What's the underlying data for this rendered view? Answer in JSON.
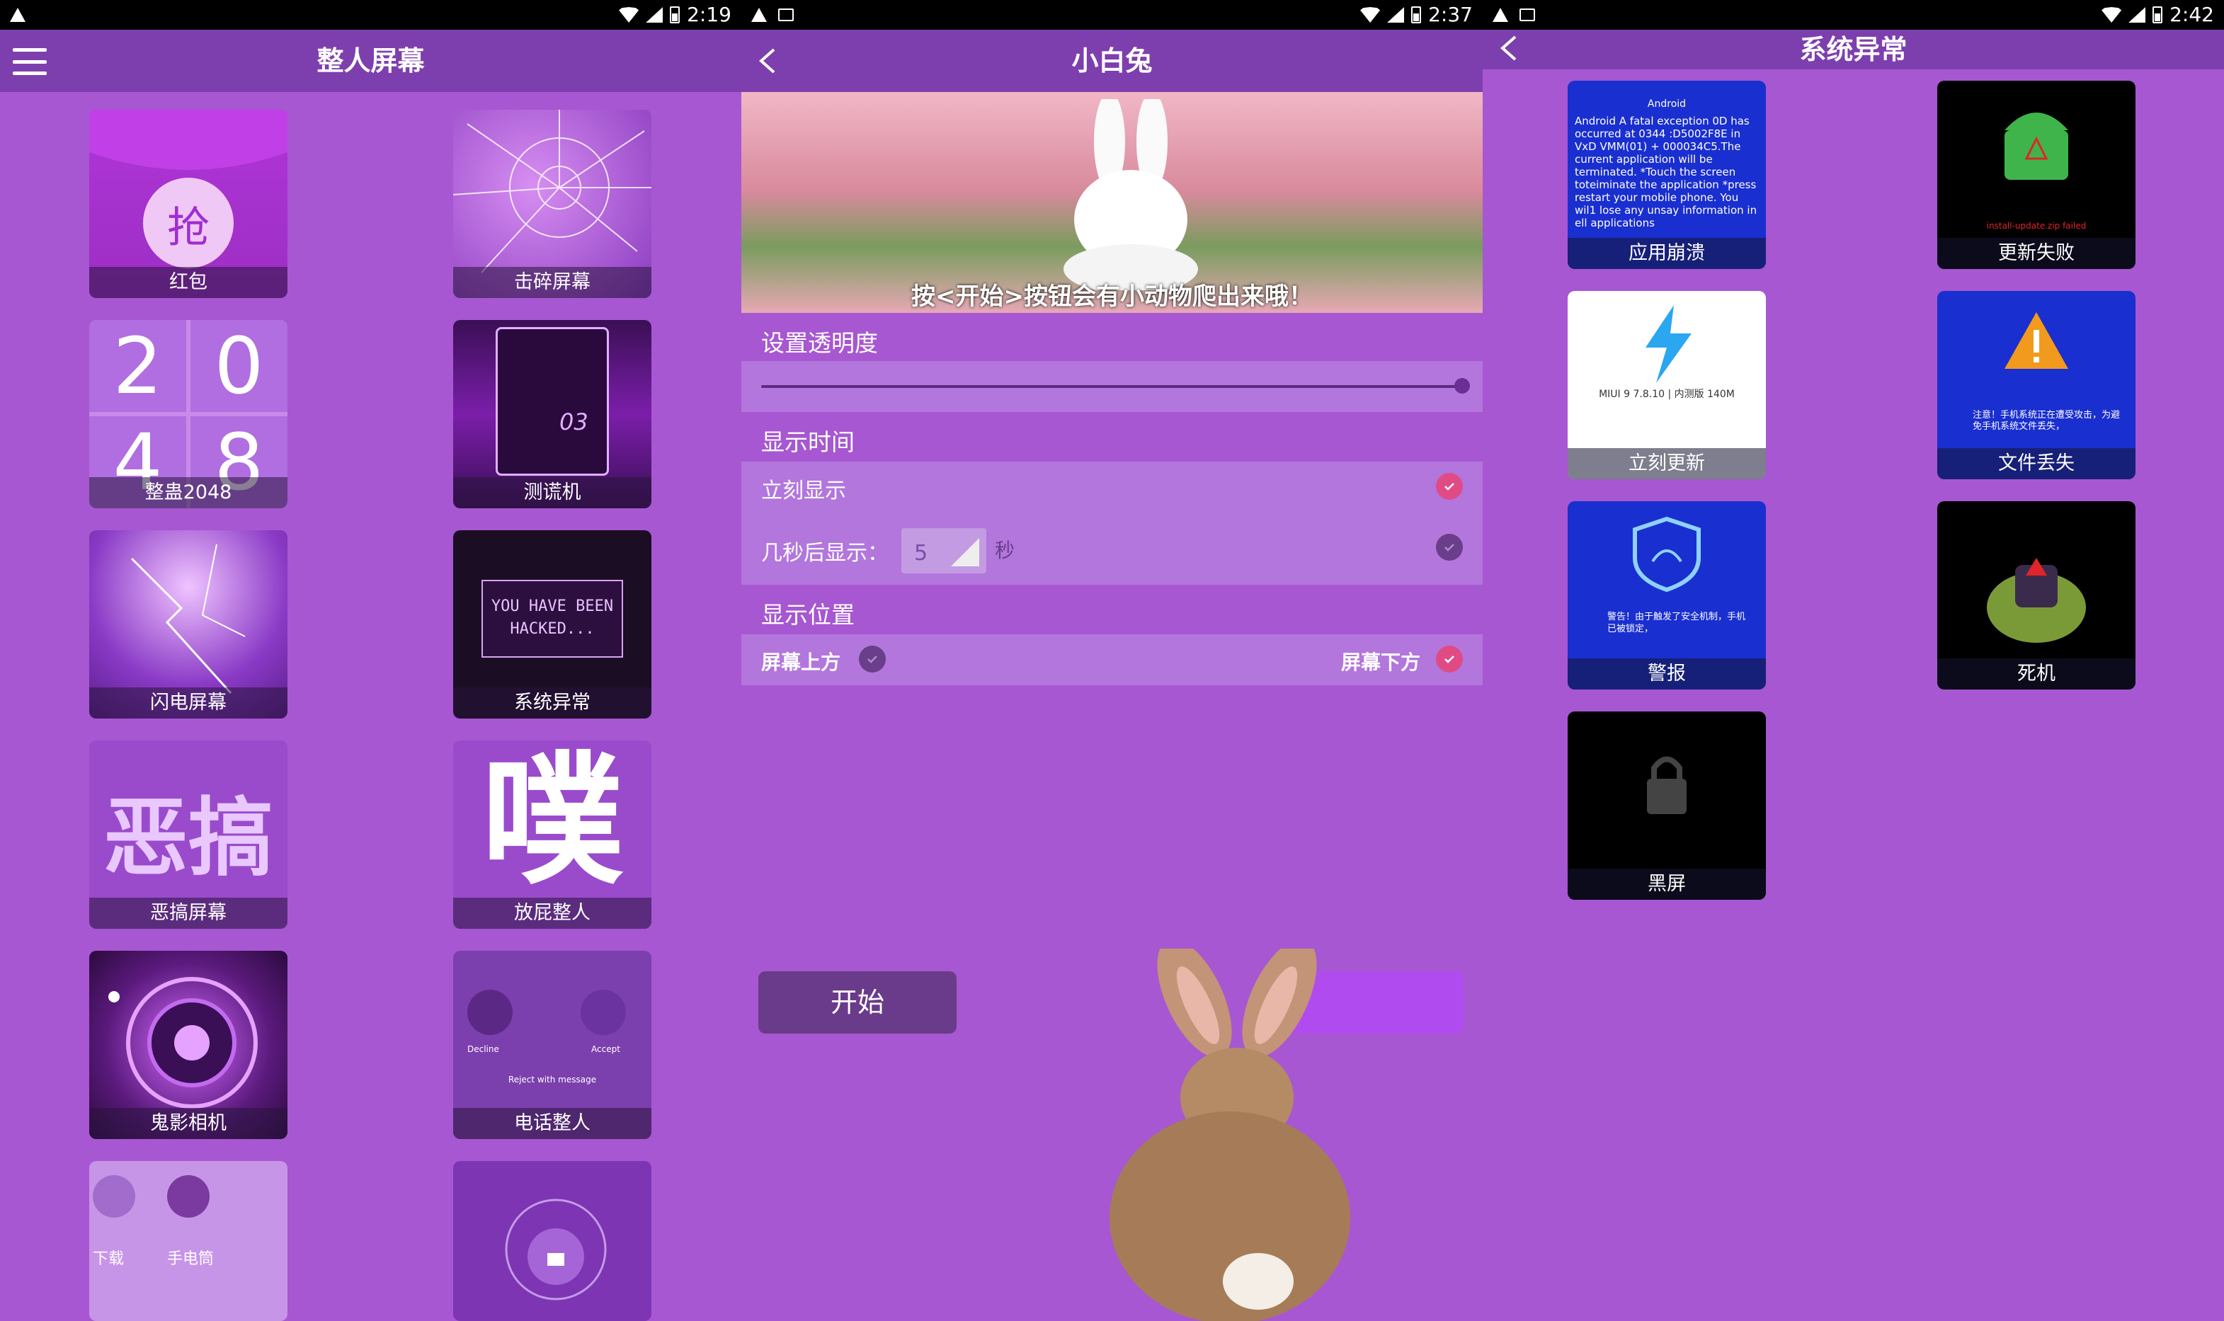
{
  "panels": [
    {
      "status": {
        "time": "2:19"
      },
      "title": "整人屏幕",
      "tiles": [
        "红包",
        "击碎屏幕",
        "整蛊2048",
        "测谎机",
        "闪电屏幕",
        "系统异常",
        "恶搞屏幕",
        "放屁整人",
        "鬼影相机",
        "电话整人",
        "",
        ""
      ],
      "tile_text": {
        "hongbao_char": "抢",
        "digits": [
          "2",
          "0",
          "4",
          "8"
        ],
        "hacked": "YOU HAVE BEEN HACKED...",
        "prank_chars": "恶搞",
        "fart_char": "噗",
        "lie_number": "03",
        "phone_decline": "Decline",
        "phone_accept": "Accept",
        "phone_reject": "Reject with message",
        "cat_labels": [
          "下载",
          "手电筒"
        ]
      }
    },
    {
      "status": {
        "time": "2:37"
      },
      "title": "小白兔",
      "banner": "按<开始>按钮会有小动物爬出来哦！",
      "transparency_label": "设置透明度",
      "transparency_value": 1.0,
      "time_label": "显示时间",
      "immediate_label": "立刻显示",
      "delay_label": "几秒后显示：",
      "delay_value": "5",
      "delay_unit": "秒",
      "position_label": "显示位置",
      "top_label": "屏幕上方",
      "bottom_label": "屏幕下方",
      "start_button": "开始"
    },
    {
      "status": {
        "time": "2:42"
      },
      "title": "系统异常",
      "tiles": [
        "应用崩溃",
        "更新失败",
        "立刻更新",
        "文件丢失",
        "警报",
        "死机",
        "黑屏"
      ],
      "crash_text": "Android A fatal exception 0D has occurred at 0344 :D5002F8E in VxD VMM(01) + 000034C5.The current application will be terminated. *Touch the screen toteiminate the application *press restart your mobile phone. You wil1 lose any unsay information in ell applications",
      "crash_title": "Android",
      "update_fail_text": "install-update.zip failed",
      "miui_text": "MIUI 9 7.8.10 | 内测版 140M",
      "lost_text": "注意！手机系统正在遭受攻击，为避免手机系统文件丢失，",
      "alarm_text": "警告！由于触发了安全机制，手机已被锁定，"
    }
  ],
  "colors": {
    "bg": "#a757d1",
    "bar": "#7e3fae",
    "accent": "#e04b86"
  }
}
